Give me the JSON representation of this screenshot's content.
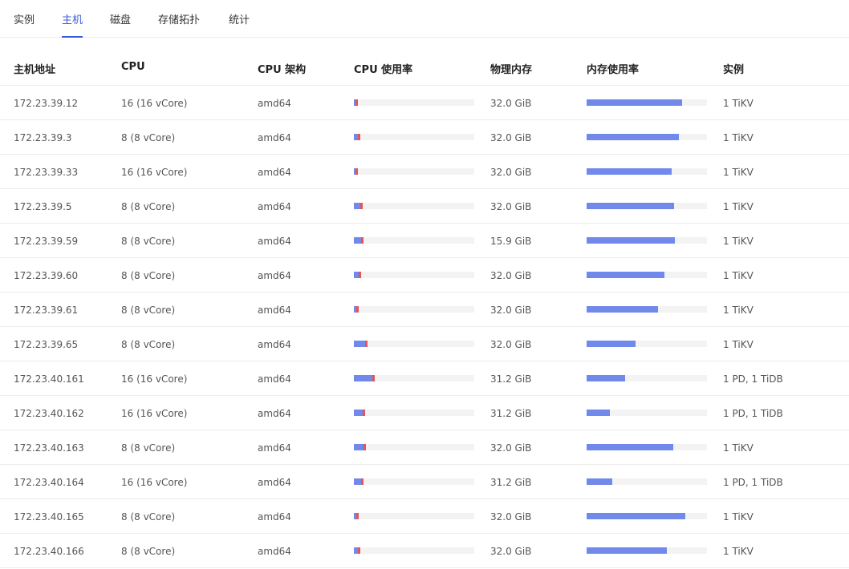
{
  "colors": {
    "accent": "#3b5bdb",
    "bar_fill": "#7089ea",
    "bar_track": "#f3f3f3",
    "cpu_peak": "#e45656"
  },
  "tabs": [
    {
      "label": "实例",
      "active": false
    },
    {
      "label": "主机",
      "active": true
    },
    {
      "label": "磁盘",
      "active": false
    },
    {
      "label": "存储拓扑",
      "active": false
    },
    {
      "label": "统计",
      "active": false
    }
  ],
  "table": {
    "headers": [
      "主机地址",
      "CPU",
      "CPU 架构",
      "CPU 使用率",
      "物理内存",
      "内存使用率",
      "实例"
    ],
    "rows": [
      {
        "host": "172.23.39.12",
        "cpu": "16 (16 vCore)",
        "arch": "amd64",
        "cpu_usage": 0.033,
        "memory": "32.0 GiB",
        "mem_usage": 0.793,
        "instances": "1 TiKV"
      },
      {
        "host": "172.23.39.3",
        "cpu": "8 (8 vCore)",
        "arch": "amd64",
        "cpu_usage": 0.053,
        "memory": "32.0 GiB",
        "mem_usage": 0.767,
        "instances": "1 TiKV"
      },
      {
        "host": "172.23.39.33",
        "cpu": "16 (16 vCore)",
        "arch": "amd64",
        "cpu_usage": 0.033,
        "memory": "32.0 GiB",
        "mem_usage": 0.707,
        "instances": "1 TiKV"
      },
      {
        "host": "172.23.39.5",
        "cpu": "8 (8 vCore)",
        "arch": "amd64",
        "cpu_usage": 0.073,
        "memory": "32.0 GiB",
        "mem_usage": 0.727,
        "instances": "1 TiKV"
      },
      {
        "host": "172.23.39.59",
        "cpu": "8 (8 vCore)",
        "arch": "amd64",
        "cpu_usage": 0.08,
        "memory": "15.9 GiB",
        "mem_usage": 0.733,
        "instances": "1 TiKV"
      },
      {
        "host": "172.23.39.60",
        "cpu": "8 (8 vCore)",
        "arch": "amd64",
        "cpu_usage": 0.06,
        "memory": "32.0 GiB",
        "mem_usage": 0.647,
        "instances": "1 TiKV"
      },
      {
        "host": "172.23.39.61",
        "cpu": "8 (8 vCore)",
        "arch": "amd64",
        "cpu_usage": 0.04,
        "memory": "32.0 GiB",
        "mem_usage": 0.593,
        "instances": "1 TiKV"
      },
      {
        "host": "172.23.39.65",
        "cpu": "8 (8 vCore)",
        "arch": "amd64",
        "cpu_usage": 0.113,
        "memory": "32.0 GiB",
        "mem_usage": 0.407,
        "instances": "1 TiKV"
      },
      {
        "host": "172.23.40.161",
        "cpu": "16 (16 vCore)",
        "arch": "amd64",
        "cpu_usage": 0.173,
        "memory": "31.2 GiB",
        "mem_usage": 0.32,
        "instances": "1 PD, 1 TiDB"
      },
      {
        "host": "172.23.40.162",
        "cpu": "16 (16 vCore)",
        "arch": "amd64",
        "cpu_usage": 0.093,
        "memory": "31.2 GiB",
        "mem_usage": 0.193,
        "instances": "1 PD, 1 TiDB"
      },
      {
        "host": "172.23.40.163",
        "cpu": "8 (8 vCore)",
        "arch": "amd64",
        "cpu_usage": 0.1,
        "memory": "32.0 GiB",
        "mem_usage": 0.72,
        "instances": "1 TiKV"
      },
      {
        "host": "172.23.40.164",
        "cpu": "16 (16 vCore)",
        "arch": "amd64",
        "cpu_usage": 0.08,
        "memory": "31.2 GiB",
        "mem_usage": 0.213,
        "instances": "1 PD, 1 TiDB"
      },
      {
        "host": "172.23.40.165",
        "cpu": "8 (8 vCore)",
        "arch": "amd64",
        "cpu_usage": 0.04,
        "memory": "32.0 GiB",
        "mem_usage": 0.82,
        "instances": "1 TiKV"
      },
      {
        "host": "172.23.40.166",
        "cpu": "8 (8 vCore)",
        "arch": "amd64",
        "cpu_usage": 0.053,
        "memory": "32.0 GiB",
        "mem_usage": 0.667,
        "instances": "1 TiKV"
      }
    ]
  }
}
